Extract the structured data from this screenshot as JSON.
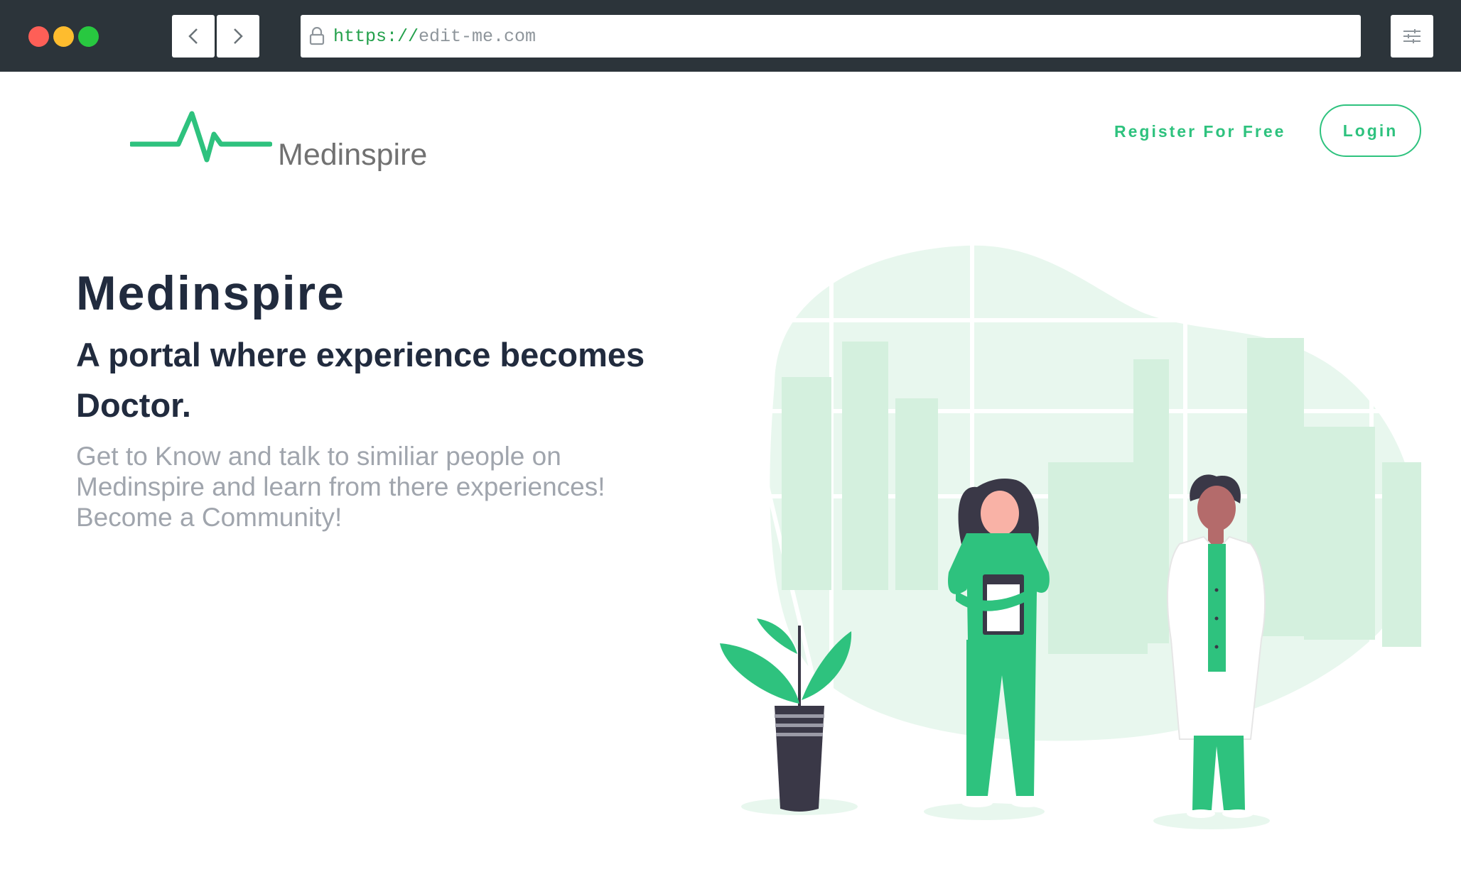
{
  "browser": {
    "url_scheme": "https://",
    "url_host": "edit-me.com",
    "icons": [
      "close-dot",
      "minimize-dot",
      "maximize-dot",
      "chevron-left-icon",
      "chevron-right-icon",
      "lock-icon",
      "sliders-icon"
    ]
  },
  "header": {
    "logo_text": "Medinspire",
    "register_label": "Register For Free",
    "login_label": "Login"
  },
  "hero": {
    "title": "Medinspire",
    "subtitle": "A portal where experience becomes Doctor.",
    "description": "Get to Know and talk to similiar people on Medinspire and learn from there experiences! Become a Community!"
  },
  "colors": {
    "brand_green": "#2ec27e",
    "heading": "#212b3e",
    "muted_text": "#a0a5ad",
    "chrome_bg": "#2c343a"
  }
}
